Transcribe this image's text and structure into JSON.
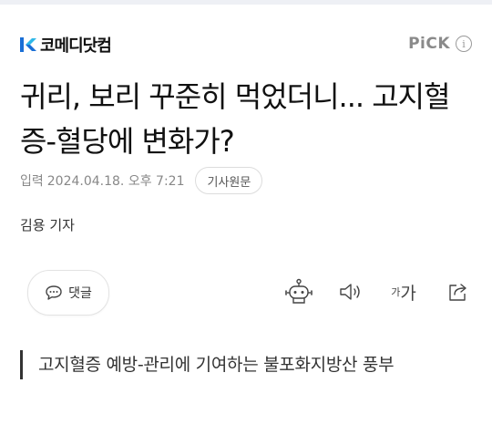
{
  "press": {
    "name": "코메디닷컴",
    "logo_icon": "comedydotcom-logo-icon"
  },
  "pick": {
    "label": "PiCK",
    "info_icon": "info-icon"
  },
  "headline": "귀리, 보리 꾸준히 먹었더니... 고지혈증-혈당에 변화가?",
  "meta": {
    "label": "입력",
    "datetime": "2024.04.18. 오후 7:21",
    "origin_button": "기사원문"
  },
  "reporter": "김용 기자",
  "toolbar": {
    "comment_label": "댓글",
    "font_small": "가",
    "font_large": "가"
  },
  "summary": "고지혈증 예방-관리에 기여하는 불포화지방산 풍부",
  "colors": {
    "logo_blue": "#1a6fd6",
    "logo_cyan": "#2fb8e8",
    "text": "#111111",
    "meta": "#888888"
  }
}
